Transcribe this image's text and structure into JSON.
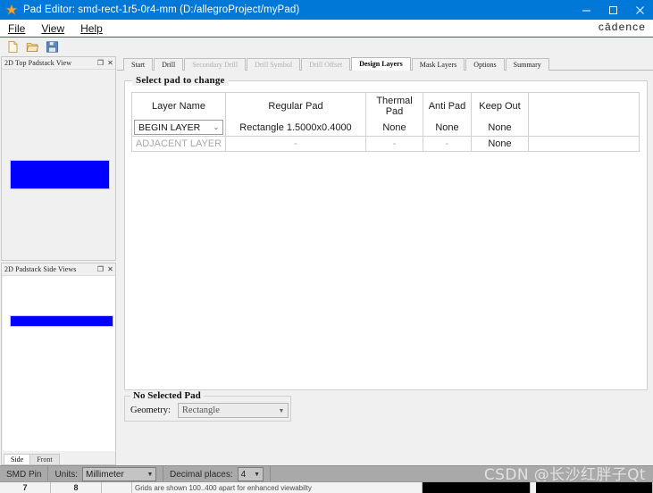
{
  "window": {
    "title": "Pad Editor: smd-rect-1r5-0r4-mm  (D:/allegroProject/myPad)",
    "app_icon": "padeditor-icon",
    "minimize_label": "Minimize",
    "maximize_label": "Maximize",
    "close_label": "Close",
    "brand": "cādence",
    "accent_color": "#0078d7",
    "brand_rule_color": "#e02020"
  },
  "menu": {
    "items": [
      {
        "label": "File"
      },
      {
        "label": "View"
      },
      {
        "label": "Help"
      }
    ]
  },
  "toolbar": {
    "buttons": [
      {
        "name": "new-file-icon",
        "tooltip": "New"
      },
      {
        "name": "open-file-icon",
        "tooltip": "Open"
      },
      {
        "name": "save-file-icon",
        "tooltip": "Save"
      }
    ]
  },
  "panels": {
    "top_view": {
      "title": "2D Top Padstack View",
      "float_label": "❐",
      "close_label": "✕",
      "pad_color": "#0000ff"
    },
    "side_view": {
      "title": "2D Padstack Side Views",
      "float_label": "❐",
      "close_label": "✕",
      "pad_color": "#0000ff",
      "tabs": [
        {
          "label": "Side",
          "active": true
        },
        {
          "label": "Front",
          "active": false
        }
      ]
    }
  },
  "tabs": [
    {
      "label": "Start",
      "state": "normal"
    },
    {
      "label": "Drill",
      "state": "normal"
    },
    {
      "label": "Secondary Drill",
      "state": "disabled"
    },
    {
      "label": "Drill Symbol",
      "state": "disabled"
    },
    {
      "label": "Drill Offset",
      "state": "disabled"
    },
    {
      "label": "Design Layers",
      "state": "active"
    },
    {
      "label": "Mask Layers",
      "state": "normal"
    },
    {
      "label": "Options",
      "state": "normal"
    },
    {
      "label": "Summary",
      "state": "normal"
    }
  ],
  "design_layers": {
    "group_title": "Select pad to change",
    "columns": [
      "Layer Name",
      "Regular Pad",
      "Thermal Pad",
      "Anti Pad",
      "Keep Out"
    ],
    "rows": [
      {
        "layer_name": "BEGIN LAYER",
        "layer_name_is_combo": true,
        "layer_name_dim": false,
        "regular_pad": "Rectangle 1.5000x0.4000",
        "thermal_pad": "None",
        "anti_pad": "None",
        "keep_out": "None",
        "dim_values": false
      },
      {
        "layer_name": "ADJACENT LAYER",
        "layer_name_is_combo": false,
        "layer_name_dim": true,
        "regular_pad": "-",
        "thermal_pad": "-",
        "anti_pad": "-",
        "keep_out": "None",
        "dim_values": true
      }
    ],
    "chevron": "⌄"
  },
  "selected_pad": {
    "group_title": "No Selected Pad",
    "geometry_label": "Geometry:",
    "geometry_value": "Rectangle",
    "chevron": "▼"
  },
  "statusbar": {
    "pin_type": "SMD Pin",
    "units_label": "Units:",
    "units_value": "Millimeter",
    "decimals_label": "Decimal places:",
    "decimals_value": "4",
    "chevron": "▼",
    "watermark": "CSDN @长沙红胖子Qt"
  },
  "background_window": {
    "col_a": "7",
    "col_b": "8",
    "col_c": "",
    "note": "Grids are shown 100..400 apart for enhanced viewabilty"
  }
}
